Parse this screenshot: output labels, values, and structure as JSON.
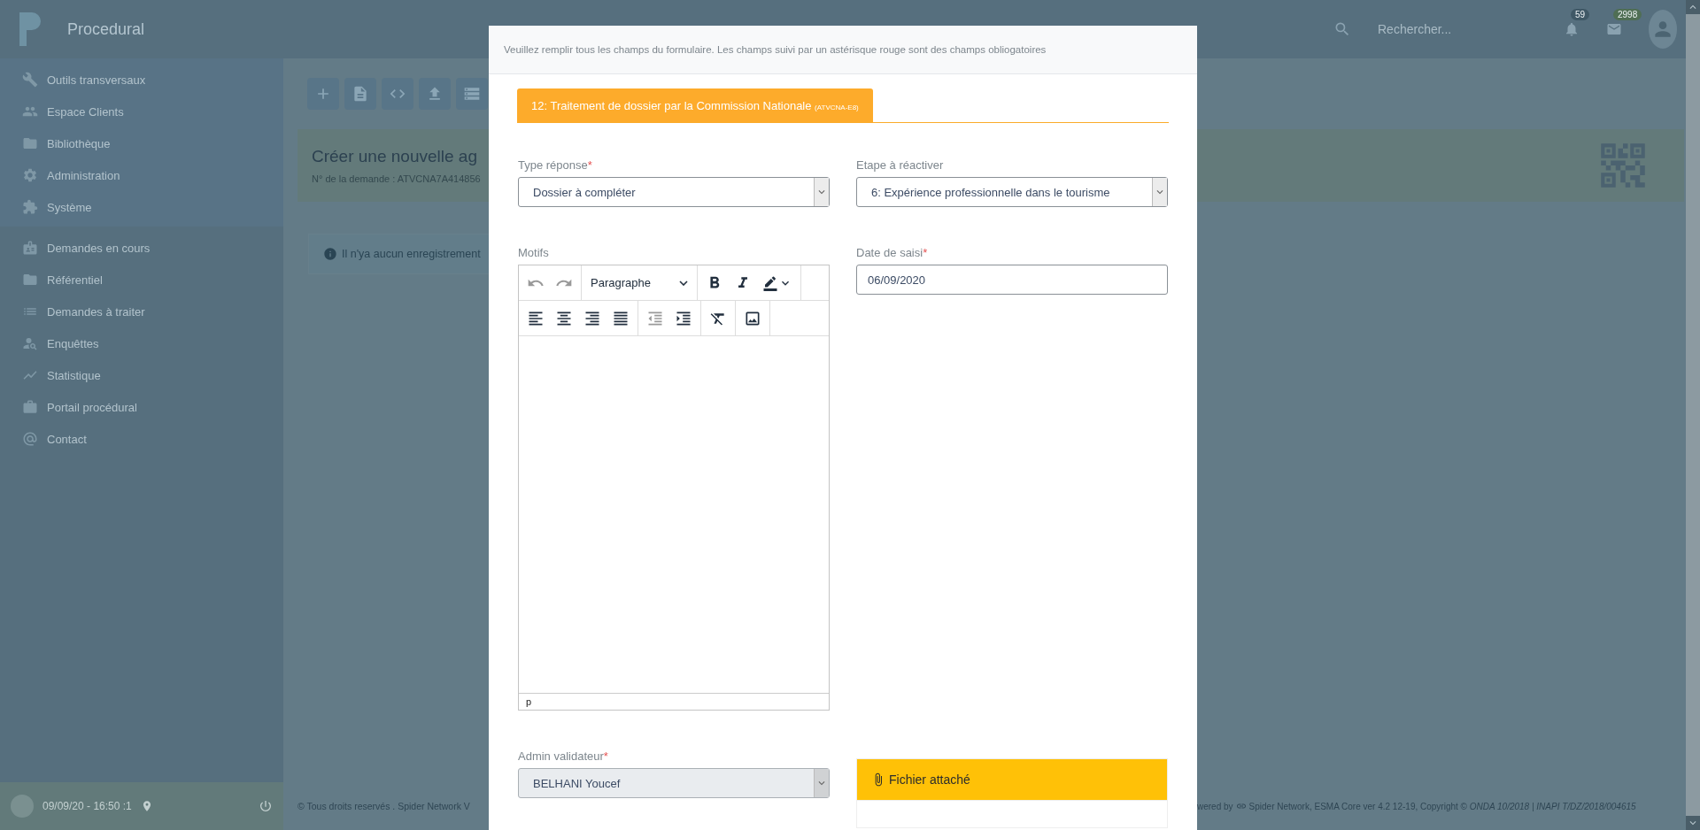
{
  "topbar": {
    "brand": "Procedural",
    "search": {
      "placeholder": "Rechercher..."
    },
    "notifications": "59",
    "messages": "2998"
  },
  "sidebar": {
    "tool_items": [
      {
        "label": "Outils transversaux"
      },
      {
        "label": "Espace Clients"
      },
      {
        "label": "Bibliothèque"
      },
      {
        "label": "Administration"
      },
      {
        "label": "Système"
      }
    ],
    "items": [
      {
        "label": "Demandes en cours"
      },
      {
        "label": "Référentiel"
      },
      {
        "label": "Demandes à traiter"
      },
      {
        "label": "Enquêttes"
      },
      {
        "label": "Statistique"
      },
      {
        "label": "Portail procédural"
      },
      {
        "label": "Contact"
      }
    ],
    "footer": {
      "time": "09/09/20 - 16:50 :1"
    }
  },
  "content": {
    "title": "Créer une nouvelle ag",
    "subtitle": "N° de la demande : ATVCNA7A414856",
    "empty_message": "Il n'ya aucun enregistrement"
  },
  "footer": {
    "left": "© Tous droits reservés . Spider Network V",
    "right_prefix": "wered by",
    "right": "Spider Network, ESMA Core ver 4.2 12-19, Copyright © *ONDA 10/2018 | INAPI T/DZ/2018/004615*"
  },
  "modal": {
    "notice": "Veuillez remplir tous les champs du formulaire. Les champs suivi par un astérisque rouge sont des champs obliogatoires",
    "step_tab": {
      "label": "12: Traitement de dossier par la Commission Nationale",
      "code": "(ATVCNA-E8)",
      "selected": true
    },
    "fields": [
      {
        "kind": "select",
        "label": "Type réponse",
        "required_mark": "*",
        "value": "Dossier à compléter",
        "disabled": false
      },
      {
        "kind": "select",
        "label": "Etape à réactiver",
        "value": "6: Expérience professionnelle dans le tourisme",
        "disabled": false
      },
      {
        "kind": "editor",
        "label": "Motifs",
        "block_format": "Paragraphe",
        "path": "p"
      },
      {
        "kind": "input",
        "label": "Date de saisi",
        "required_mark": "*",
        "value": "06/09/2020"
      },
      {
        "kind": "select",
        "label": "Admin validateur",
        "required_mark": "*",
        "value": "BELHANI Youcef",
        "disabled": true
      },
      {
        "kind": "attachment",
        "label": "Fichier attaché"
      }
    ]
  }
}
